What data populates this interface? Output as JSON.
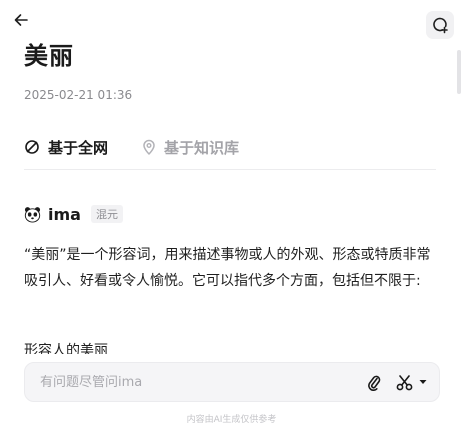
{
  "header": {
    "back_icon": "arrow-left-icon",
    "new_chat_icon": "chat-plus-icon"
  },
  "article": {
    "title": "美丽",
    "timestamp": "2025-02-21 01:36"
  },
  "tabs": [
    {
      "label": "基于全网",
      "icon": "globe-slash-icon",
      "active": true
    },
    {
      "label": "基于知识库",
      "icon": "location-pin-icon",
      "active": false
    }
  ],
  "answer": {
    "author": "ima",
    "avatar_icon": "panda-icon",
    "model_badge": "混元",
    "paragraph": "“美丽”是一个形容词，用来描述事物或人的外观、形态或特质非常吸引人、好看或令人愉悦。它可以指代多个方面，包括但不限于:",
    "next_line": "形容人的美丽"
  },
  "composer": {
    "placeholder": "有问题尽管问ima",
    "attach_icon": "paperclip-icon",
    "scissors_icon": "scissors-icon",
    "dropdown_icon": "caret-down-icon"
  },
  "footer": {
    "disclaimer": "内容由AI生成仅供参考"
  },
  "colors": {
    "text": "#1a1a1a",
    "muted": "#8a8a8e",
    "inactive_tab": "#a3a3a8",
    "input_bg": "#f5f5f7"
  }
}
